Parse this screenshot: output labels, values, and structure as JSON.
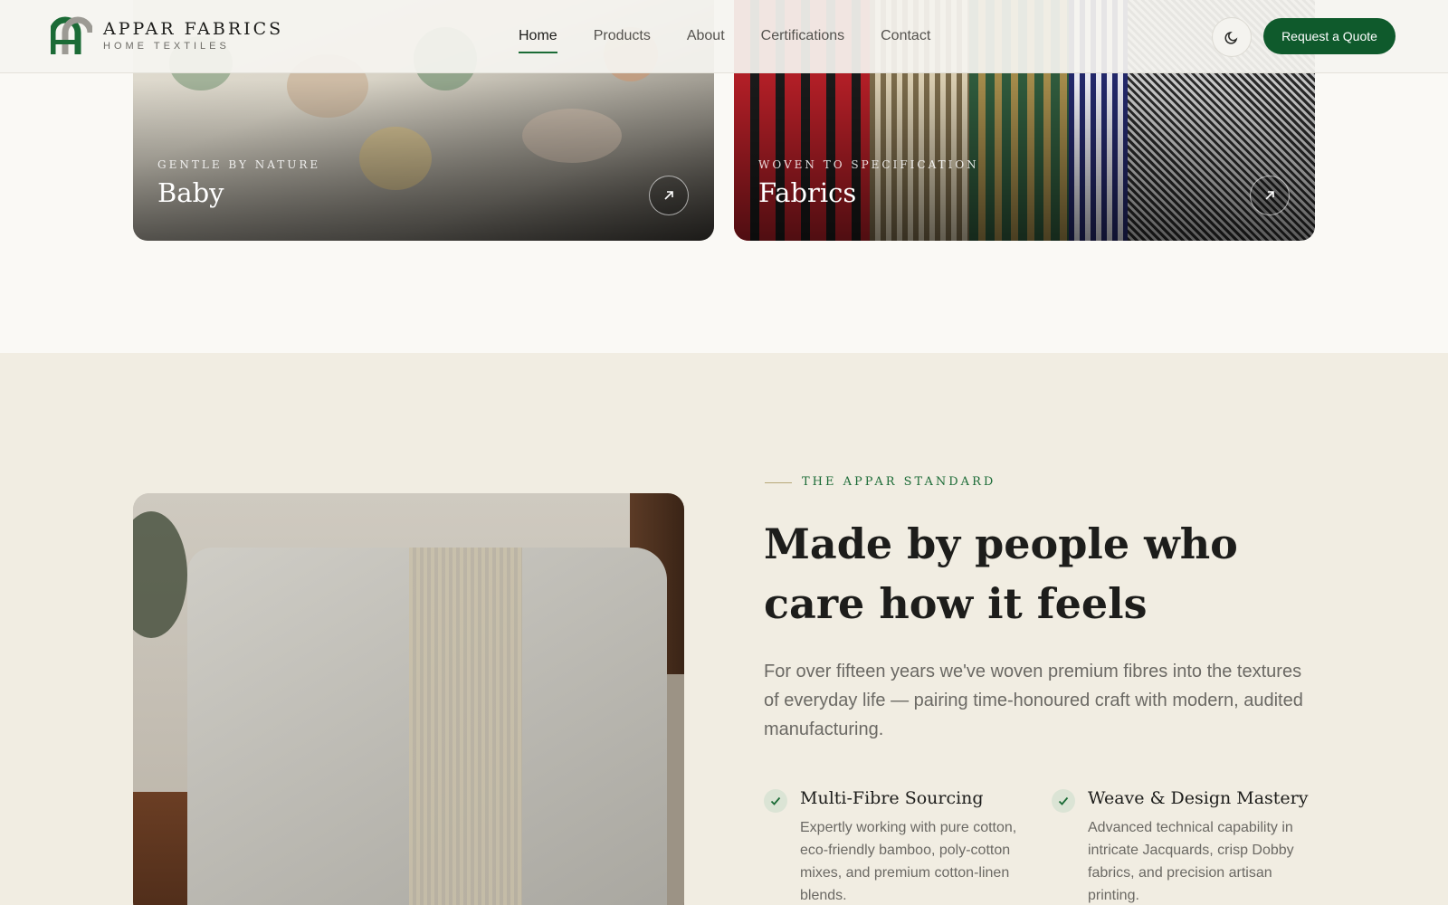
{
  "header": {
    "brand_name": "APPAR FABRICS",
    "brand_sub": "HOME TEXTILES",
    "nav": [
      "Home",
      "Products",
      "About",
      "Certifications",
      "Contact"
    ],
    "active_nav": "Home",
    "theme_icon": "moon-icon",
    "quote_label": "Request a Quote",
    "accent_color": "#0f5a2c"
  },
  "cards": [
    {
      "eyebrow": "GENTLE BY NATURE",
      "title": "Baby",
      "icon": "arrow-up-right-icon"
    },
    {
      "eyebrow": "WOVEN TO SPECIFICATION",
      "title": "Fabrics",
      "icon": "arrow-up-right-icon"
    }
  ],
  "standard": {
    "eyebrow": "THE APPAR STANDARD",
    "headline": "Made by people who care how it feels",
    "intro": "For over fifteen years we've woven premium fibres into the textures of everyday life — pairing time-honoured craft with modern, audited manufacturing.",
    "features": [
      {
        "title": "Multi-Fibre Sourcing",
        "desc": "Expertly working with pure cotton, eco-friendly bamboo, poly-cotton mixes, and premium cotton-linen blends."
      },
      {
        "title": "Weave & Design Mastery",
        "desc": "Advanced technical capability in intricate Jacquards, crisp Dobby fabrics, and precision artisan printing."
      }
    ]
  }
}
